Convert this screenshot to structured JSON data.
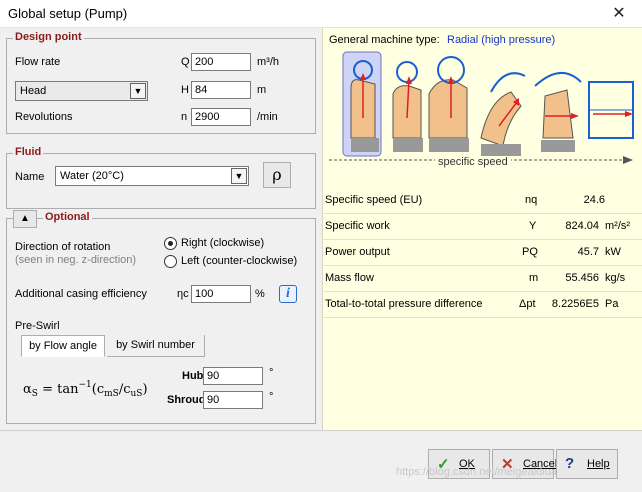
{
  "window": {
    "title": "Global setup (Pump)",
    "close_glyph": "✕"
  },
  "design_point": {
    "legend": "Design point",
    "flow_rate_label": "Flow rate",
    "flow_symbol": "Q",
    "flow_value": "200",
    "flow_unit": "m³/h",
    "head_select": "Head",
    "head_symbol": "H",
    "head_value": "84",
    "head_unit": "m",
    "revolutions_label": "Revolutions",
    "rev_symbol": "n",
    "rev_value": "2900",
    "rev_unit": "/min"
  },
  "fluid": {
    "legend": "Fluid",
    "name_label": "Name",
    "name_value": "Water (20°C)",
    "density_button": "ρ"
  },
  "optional": {
    "legend": "Optional",
    "collapse_glyph": "▲",
    "rotation_label": "Direction of rotation",
    "rotation_hint": "(seen in neg. z-direction)",
    "right_label": "Right (clockwise)",
    "left_label": "Left (counter-clockwise)",
    "casing_label": "Additional casing efficiency",
    "casing_symbol": "ηc",
    "casing_value": "100",
    "casing_unit": "%",
    "info_glyph": "i",
    "preswirl_label": "Pre-Swirl",
    "tab_flow_angle": "by Flow angle",
    "tab_swirl_number": "by Swirl number",
    "hub_label": "Hub",
    "hub_value": "90",
    "hub_unit": "°",
    "shroud_label": "Shroud",
    "shroud_value": "90",
    "shroud_unit": "°"
  },
  "machine": {
    "type_label": "General machine type:",
    "type_value": "Radial (high pressure)",
    "axis_caption": "specific speed"
  },
  "results": [
    {
      "label": "Specific speed (EU)",
      "symbol": "nq",
      "value": "24.6",
      "unit": ""
    },
    {
      "label": "Specific work",
      "symbol": "Y",
      "value": "824.04",
      "unit": "m²/s²"
    },
    {
      "label": "Power output",
      "symbol": "PQ",
      "value": "45.7",
      "unit": "kW"
    },
    {
      "label": "Mass flow",
      "symbol": "m",
      "value": "55.456",
      "unit": "kg/s"
    },
    {
      "label": "Total-to-total pressure difference",
      "symbol": "Δpt",
      "value": "8.2256E5",
      "unit": "Pa"
    }
  ],
  "buttons": {
    "ok": "OK",
    "cancel": "Cancel",
    "help": "Help"
  },
  "watermark": "https://blog.csdn.net/meigeaidiua",
  "colors": {
    "accent": "#8b1a1a",
    "highlight_blue": "#1a34c7",
    "result_bg": "#ffffe1"
  }
}
